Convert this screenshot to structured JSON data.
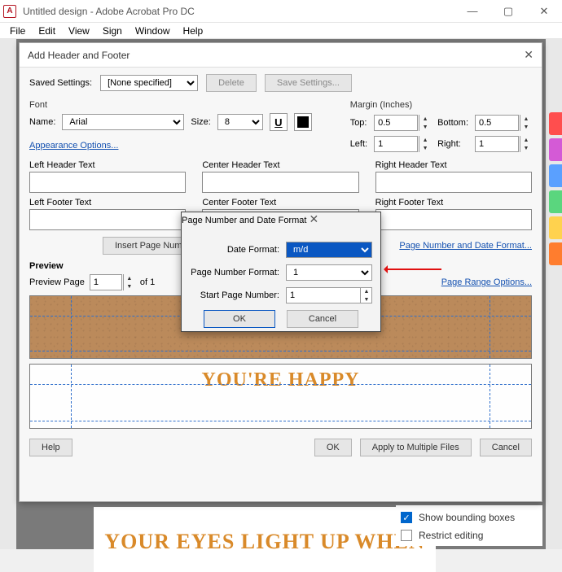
{
  "window": {
    "title": "Untitled design - Adobe Acrobat Pro DC",
    "app_letter": "A"
  },
  "menubar": [
    "File",
    "Edit",
    "View",
    "Sign",
    "Window",
    "Help"
  ],
  "dialog": {
    "title": "Add Header and Footer",
    "saved_settings_label": "Saved Settings:",
    "saved_settings_value": "[None specified]",
    "delete_label": "Delete",
    "save_settings_label": "Save Settings...",
    "font_group": "Font",
    "name_label": "Name:",
    "name_value": "Arial",
    "size_label": "Size:",
    "size_value": "8",
    "appearance_link": "Appearance Options...",
    "margin_group": "Margin (Inches)",
    "margin_top_label": "Top:",
    "margin_top_value": "0.5",
    "margin_bottom_label": "Bottom:",
    "margin_bottom_value": "0.5",
    "margin_left_label": "Left:",
    "margin_left_value": "1",
    "margin_right_label": "Right:",
    "margin_right_value": "1",
    "left_header": "Left Header Text",
    "center_header": "Center Header Text",
    "right_header": "Right Header Text",
    "left_footer": "Left Footer Text",
    "center_footer": "Center Footer Text",
    "right_footer": "Right Footer Text",
    "insert_page_number": "Insert Page Number",
    "page_number_date_link": "Page Number and Date Format...",
    "preview_label": "Preview",
    "preview_page_label": "Preview Page",
    "preview_page_value": "1",
    "preview_of": "of 1",
    "page_range_link": "Page Range Options...",
    "happy_text": "YOU'RE HAPPY",
    "help_label": "Help",
    "ok_label": "OK",
    "apply_label": "Apply to Multiple Files",
    "cancel_label": "Cancel"
  },
  "subdialog": {
    "title": "Page Number and Date Format",
    "date_format_label": "Date Format:",
    "date_format_value": "m/d",
    "page_number_format_label": "Page Number Format:",
    "page_number_format_value": "1",
    "start_page_label": "Start Page Number:",
    "start_page_value": "1",
    "ok_label": "OK",
    "cancel_label": "Cancel"
  },
  "background_panel": {
    "doc_text": "YOUR EYES LIGHT UP WHEN",
    "show_bounding": "Show bounding boxes",
    "restrict_editing": "Restrict editing"
  }
}
